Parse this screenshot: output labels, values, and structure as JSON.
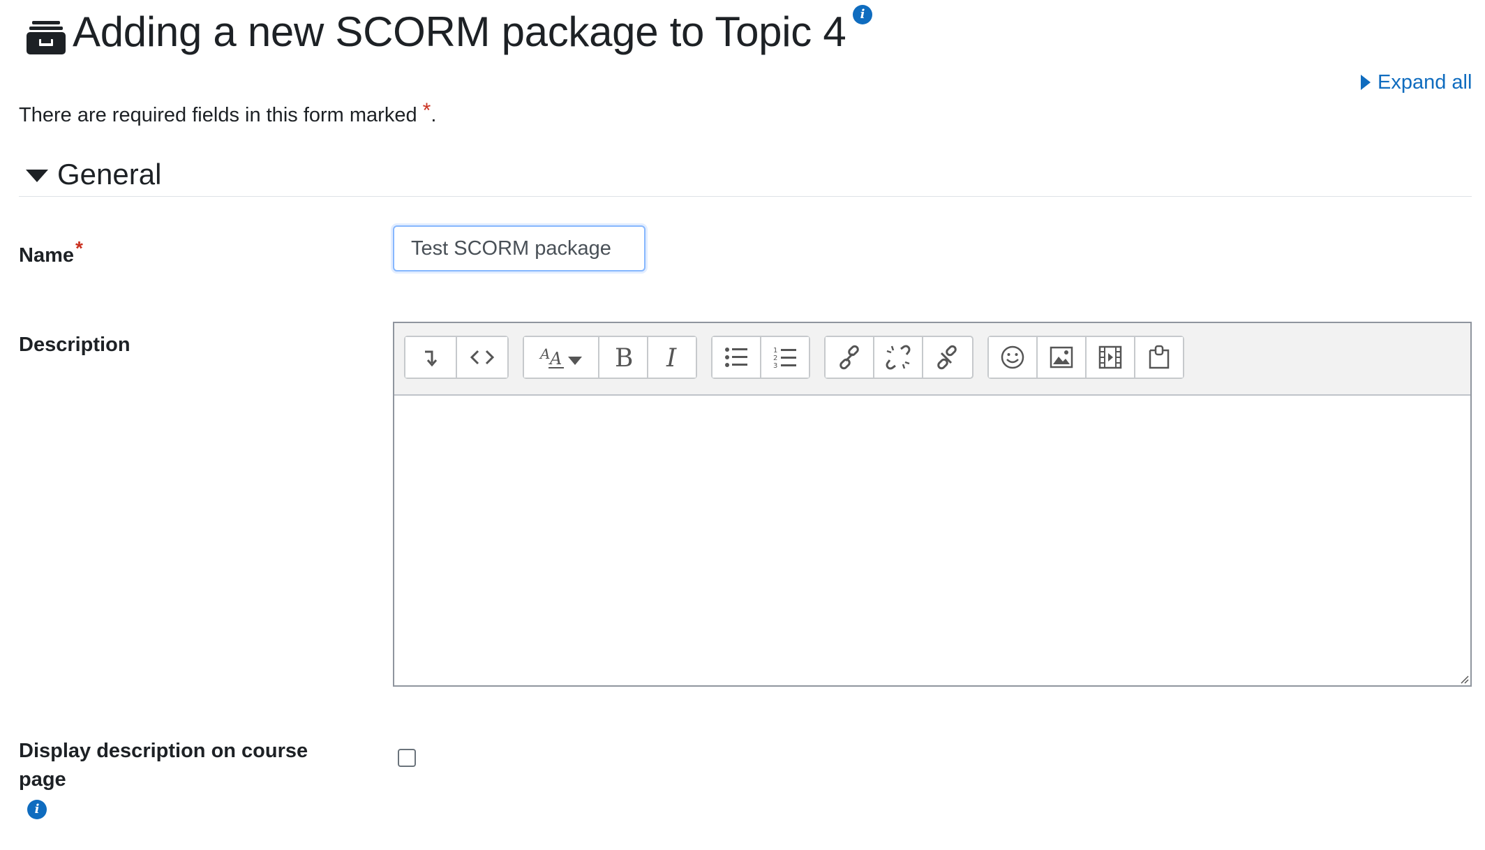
{
  "header": {
    "title": "Adding a new SCORM package to Topic 4",
    "icon": "package-icon",
    "help_icon": "info-icon"
  },
  "expand_all_label": "Expand all",
  "required_notice": {
    "text": "There are required fields in this form marked ",
    "marker": "*",
    "suffix": "."
  },
  "sections": {
    "general": {
      "label": "General",
      "expanded": true
    }
  },
  "fields": {
    "name": {
      "label": "Name",
      "required_marker": "*",
      "value": "Test SCORM package"
    },
    "description": {
      "label": "Description",
      "content": "",
      "toolbar_groups": [
        [
          "toolbar-toggle-icon",
          "html-source-icon"
        ],
        [
          "font-size-icon",
          "bold-icon",
          "italic-icon"
        ],
        [
          "bulleted-list-icon",
          "numbered-list-icon"
        ],
        [
          "link-icon",
          "unlink-icon",
          "manage-links-icon"
        ],
        [
          "emoji-icon",
          "image-icon",
          "media-icon",
          "manage-files-icon"
        ]
      ]
    },
    "display_description": {
      "label": "Display description on course page",
      "checked": false,
      "help_icon": "info-icon"
    }
  },
  "colors": {
    "link": "#0f6cbf",
    "required": "#ca3120",
    "text": "#1d2125",
    "toolbar_bg": "#f2f2f2",
    "focus_border": "#86b7fe"
  }
}
